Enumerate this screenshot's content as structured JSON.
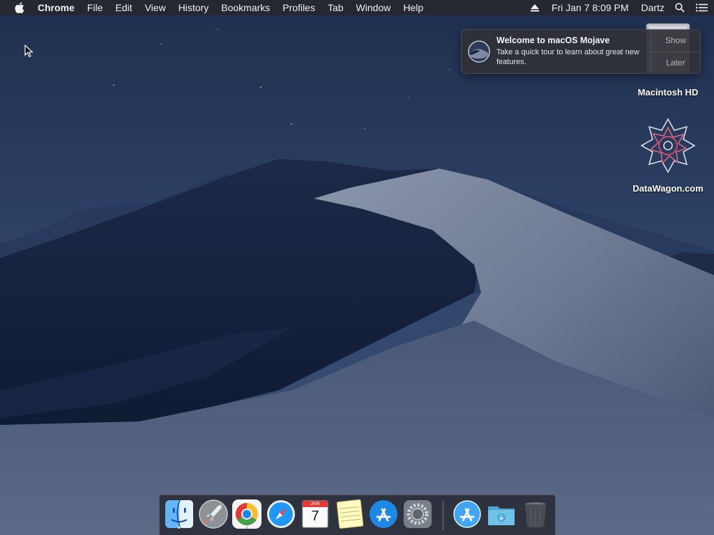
{
  "menubar": {
    "app_name": "Chrome",
    "menus": [
      "File",
      "Edit",
      "View",
      "History",
      "Bookmarks",
      "Profiles",
      "Tab",
      "Window",
      "Help"
    ],
    "clock": "Fri Jan 7  8:09 PM",
    "user": "Dartz"
  },
  "notification": {
    "title": "Welcome to macOS Mojave",
    "body": "Take a quick tour to learn about great new features.",
    "show_label": "Show",
    "later_label": "Later"
  },
  "desktop_icons": {
    "hd_label": "Macintosh HD",
    "datawagon_label": "DataWagon.com"
  },
  "dock": {
    "apps": [
      "Finder",
      "Launchpad",
      "Google Chrome",
      "Safari",
      "Calendar",
      "Notes",
      "App Store",
      "System Preferences",
      "App Store",
      "Downloads",
      "Trash"
    ],
    "calendar_month": "JAN",
    "calendar_day": "7"
  },
  "colors": {
    "menubar_bg": "#26282e",
    "accent_blue": "#1e88e5"
  }
}
